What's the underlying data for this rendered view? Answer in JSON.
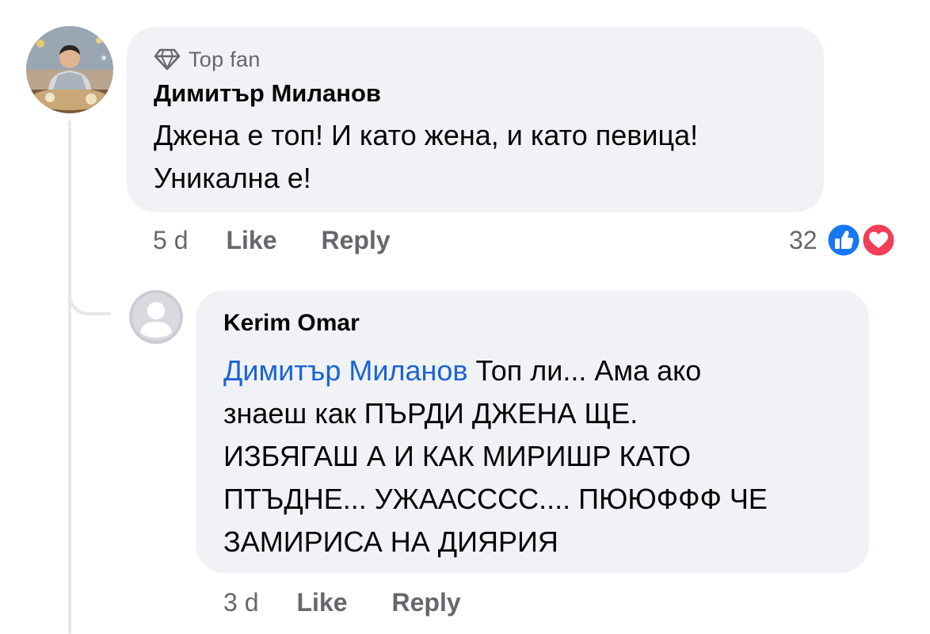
{
  "comment": {
    "badge": "Top fan",
    "badge_icon": "diamond-icon",
    "author": "Димитър Миланов",
    "text_line1": "Джена е топ! И като жена, и като певица!",
    "text_line2": "Уникална е!",
    "timestamp": "5 d",
    "like_label": "Like",
    "reply_label": "Reply",
    "reaction_count": "32",
    "reaction_icons": [
      "like-icon",
      "love-icon"
    ]
  },
  "reply": {
    "author": "Kerim Omar",
    "mention": "Димитър Миланов",
    "text_line1": " Топ ли... Ама ако",
    "text_line2": "знаеш как ПЪРДИ  ДЖЕНА  ЩЕ.",
    "text_line3": "ИЗБЯГАШ А И КАК МИРИШР  КАТО",
    "text_line4": "ПТЪДНЕ... УЖААСССС.... ПЮЮФФФ ЧЕ",
    "text_line5": "ЗАМИРИСА НА ДИЯРИЯ",
    "timestamp": "3 d",
    "like_label": "Like",
    "reply_label": "Reply"
  },
  "colors": {
    "bubble": "#f0f2f5",
    "mention": "#1a64d6",
    "secondary_text": "#65676b",
    "like_blue": "#1877f2",
    "love_red": "#f33e58"
  }
}
